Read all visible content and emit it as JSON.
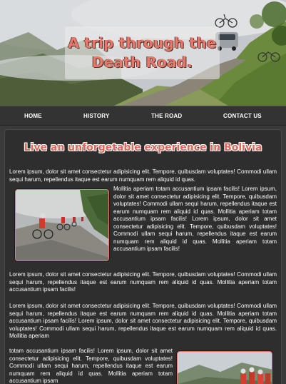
{
  "hero": {
    "title": "A trip through the Death Road."
  },
  "nav": {
    "items": [
      "HOME",
      "HISTORY",
      "THE ROAD",
      "CONTACT US"
    ]
  },
  "main": {
    "subtitle": "Live an unforgetable experience in Bolivia",
    "para1_top": "Lorem ipsum, dolor sit amet consectetur adipisicing elit. Tempore, quibusdam voluptates! Commodi ullam sequi harum, repellendus itaque est earum numquam rem aliquid id quas.",
    "para1_wrap": "Mollitia aperiam totam accusantium ipsam facilis! Lorem ipsum, dolor sit amet consectetur adipisicing elit. Tempore, quibusdam voluptates! Commodi ullam sequi harum, repellendus itaque est earum numquam rem aliquid id quas. Mollitia aperiam totam accusantium ipsam facilis! Lorem ipsum, dolor sit amet consectetur adipisicing elit. Tempore, quibusdam voluptates! Commodi ullam sequi harum, repellendus itaque est earum numquam rem aliquid id quas. Mollitia aperiam totam accusantium ipsam facilis!",
    "para1_bottom": "Lorem ipsum, dolor sit amet consectetur adipisicing elit. Tempore, quibusdam voluptates! Commodi ullam sequi harum, repellendus itaque est earum numquam rem aliquid id quas. Mollitia aperiam totam accusantium ipsam facilis!",
    "para2_top": "Lorem ipsum, dolor sit amet consectetur adipisicing elit. Tempore, quibusdam voluptates! Commodi ullam sequi harum, repellendus itaque est earum numquam rem aliquid id quas. Mollitia aperiam totam accusantium ipsam facilis! Lorem ipsum, dolor sit amet consectetur adipisicing elit. Tempore, quibusdam voluptates! Commodi ullam sequi harum, repellendus itaque est earum numquam rem aliquid id quas. Mollitia aperiam",
    "para2_wrap": "totam accusantium ipsam facilis! Lorem ipsum, dolor sit amet consectetur adipisicing elit. Tempore, quibusdam voluptates! Commodi ullam sequi harum, repellendus itaque est earum numquam rem aliquid id quas. Mollitia aperiam totam accusantium ipsam"
  },
  "colors": {
    "accent": "#e57a6c",
    "background": "#3a3a3a",
    "panel": "#2e2e2e",
    "nav": "#333333"
  }
}
